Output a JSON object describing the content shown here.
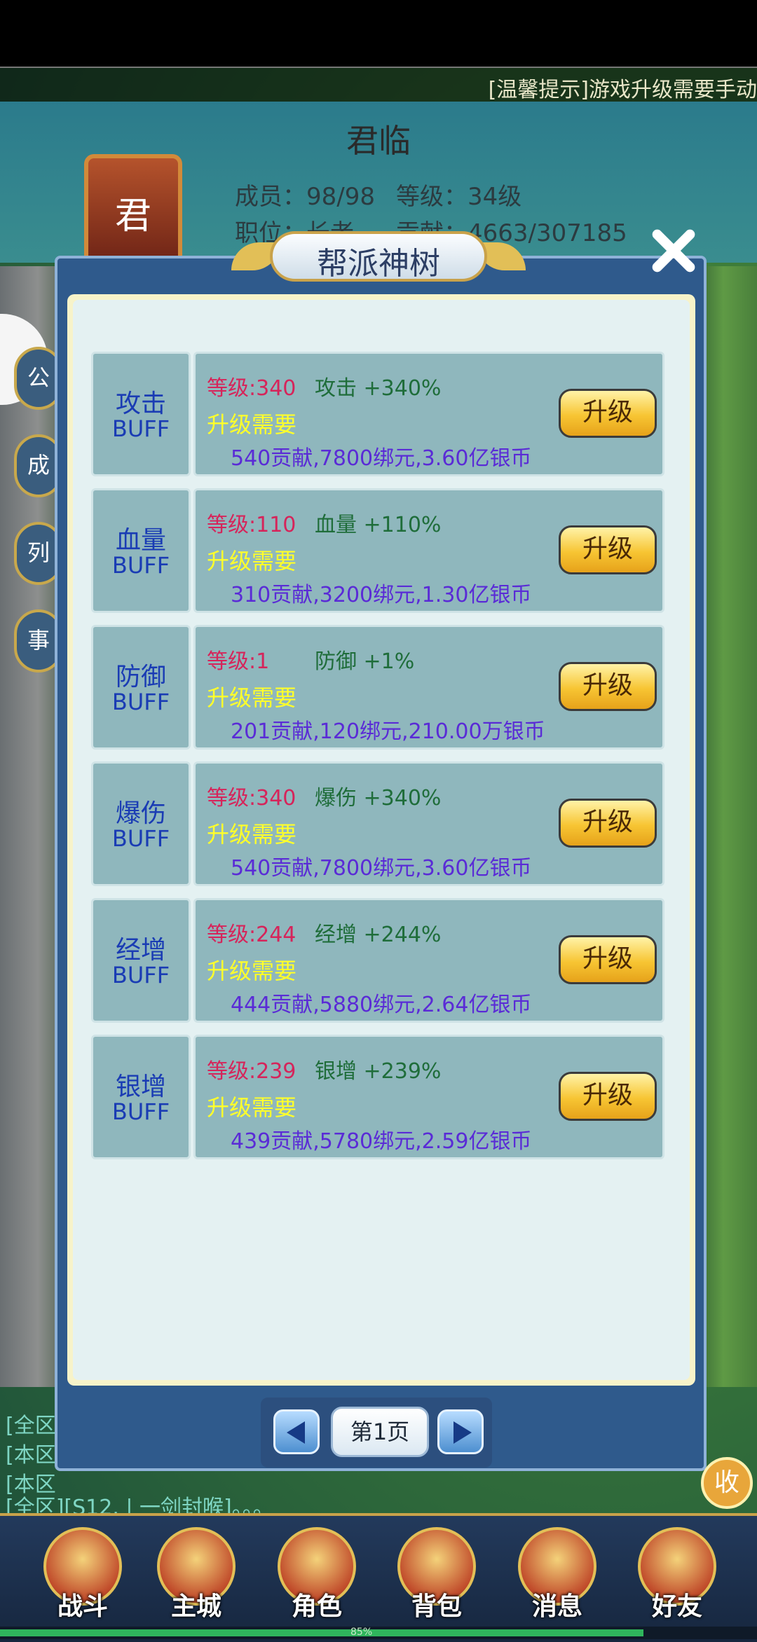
{
  "notice": "[温馨提示]游戏升级需要手动",
  "guild": {
    "name": "君临",
    "emblem_char": "君",
    "members": "成员：98/98",
    "level": "等级：34级",
    "position": "职位：长老",
    "contribution": "贡献：4663/307185"
  },
  "side_buttons": [
    "公",
    "成",
    "列",
    "事"
  ],
  "dialog": {
    "title": "帮派神树",
    "buffs": [
      {
        "name": "攻击",
        "suffix": "BUFF",
        "level": "等级:340",
        "effect": "攻击 +340%",
        "req": "升级需要",
        "cost": "540贡献,7800绑元,3.60亿银币",
        "button": "升级"
      },
      {
        "name": "血量",
        "suffix": "BUFF",
        "level": "等级:110",
        "effect": "血量 +110%",
        "req": "升级需要",
        "cost": "310贡献,3200绑元,1.30亿银币",
        "button": "升级"
      },
      {
        "name": "防御",
        "suffix": "BUFF",
        "level": "等级:1",
        "effect": "防御 +1%",
        "req": "升级需要",
        "cost": "201贡献,120绑元,210.00万银币",
        "button": "升级"
      },
      {
        "name": "爆伤",
        "suffix": "BUFF",
        "level": "等级:340",
        "effect": "爆伤 +340%",
        "req": "升级需要",
        "cost": "540贡献,7800绑元,3.60亿银币",
        "button": "升级"
      },
      {
        "name": "经增",
        "suffix": "BUFF",
        "level": "等级:244",
        "effect": "经增 +244%",
        "req": "升级需要",
        "cost": "444贡献,5880绑元,2.64亿银币",
        "button": "升级"
      },
      {
        "name": "银增",
        "suffix": "BUFF",
        "level": "等级:239",
        "effect": "银增 +239%",
        "req": "升级需要",
        "cost": "439贡献,5780绑元,2.59亿银币",
        "button": "升级"
      }
    ],
    "page": "第1页"
  },
  "chat": [
    "[全区",
    "[本区",
    "[本区",
    "[全区][S12. | 一剑封喉]。。。"
  ],
  "collapse_label": "收",
  "nav": [
    "战斗",
    "主城",
    "角色",
    "背包",
    "消息",
    "好友"
  ],
  "progress_percent": 85,
  "progress_text": "85%"
}
